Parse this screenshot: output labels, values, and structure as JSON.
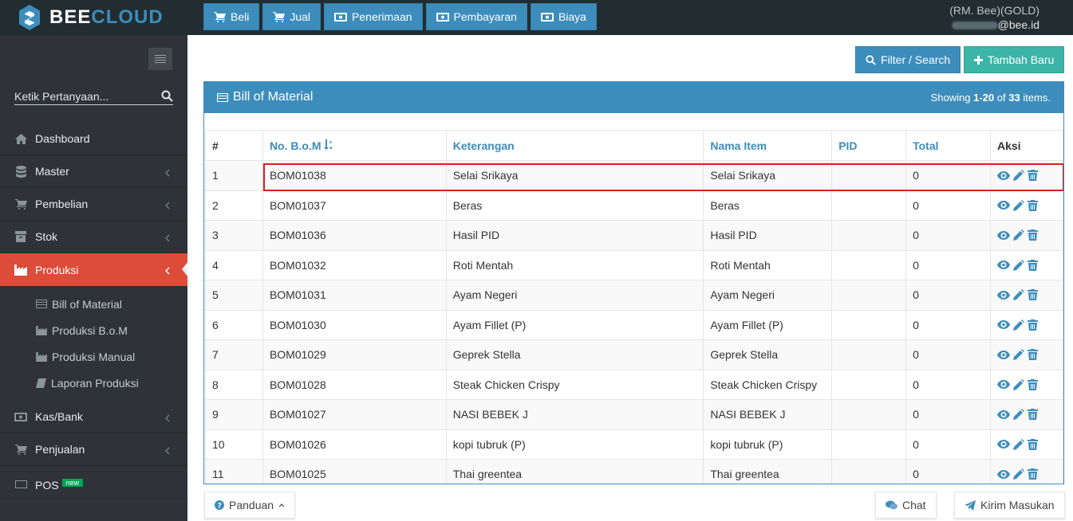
{
  "brand": {
    "name_part1": "BEE",
    "name_part2": "CLOUD"
  },
  "topnav": [
    {
      "label": "Beli",
      "icon": "cart-icon"
    },
    {
      "label": "Jual",
      "icon": "cart-icon"
    },
    {
      "label": "Penerimaan",
      "icon": "money-icon"
    },
    {
      "label": "Pembayaran",
      "icon": "money-icon"
    },
    {
      "label": "Biaya",
      "icon": "money-icon"
    }
  ],
  "user": {
    "account": "(RM. Bee)(GOLD)",
    "email_suffix": "@bee.id"
  },
  "sidebar": {
    "search_placeholder": "Ketik Pertanyaan...",
    "items": [
      {
        "label": "Dashboard",
        "icon": "home-icon"
      },
      {
        "label": "Master",
        "icon": "database-icon"
      },
      {
        "label": "Pembelian",
        "icon": "cart-icon"
      },
      {
        "label": "Stok",
        "icon": "box-icon"
      },
      {
        "label": "Produksi",
        "icon": "factory-icon"
      }
    ],
    "submenu": [
      {
        "label": "Bill of Material",
        "icon": "list-icon"
      },
      {
        "label": "Produksi B.o.M",
        "icon": "factory-icon"
      },
      {
        "label": "Produksi Manual",
        "icon": "factory-icon"
      },
      {
        "label": "Laporan Produksi",
        "icon": "book-icon"
      }
    ],
    "items_after": [
      {
        "label": "Kas/Bank",
        "icon": "money-icon"
      },
      {
        "label": "Penjualan",
        "icon": "cart-icon"
      },
      {
        "label": "POS",
        "icon": "monitor-icon",
        "badge": "new"
      }
    ]
  },
  "actions": {
    "filter_label": "Filter / Search",
    "new_label": "Tambah Baru"
  },
  "box": {
    "title": "Bill of Material",
    "showing_prefix": "Showing ",
    "showing_range": "1-20",
    "showing_mid": " of ",
    "showing_total": "33",
    "showing_suffix": " items."
  },
  "table": {
    "headers": [
      "#",
      "No. B.o.M",
      "Keterangan",
      "Nama Item",
      "PID",
      "Total",
      "Aksi"
    ],
    "rows": [
      [
        "1",
        "BOM01038",
        "Selai Srikaya",
        "Selai Srikaya",
        "",
        "0"
      ],
      [
        "2",
        "BOM01037",
        "Beras",
        "Beras",
        "",
        "0"
      ],
      [
        "3",
        "BOM01036",
        "Hasil PID",
        "Hasil PID",
        "",
        "0"
      ],
      [
        "4",
        "BOM01032",
        "Roti Mentah",
        "Roti Mentah",
        "",
        "0"
      ],
      [
        "5",
        "BOM01031",
        "Ayam Negeri",
        "Ayam Negeri",
        "",
        "0"
      ],
      [
        "6",
        "BOM01030",
        "Ayam Fillet (P)",
        "Ayam Fillet (P)",
        "",
        "0"
      ],
      [
        "7",
        "BOM01029",
        "Geprek Stella",
        "Geprek Stella",
        "",
        "0"
      ],
      [
        "8",
        "BOM01028",
        "Steak Chicken Crispy",
        "Steak Chicken Crispy",
        "",
        "0"
      ],
      [
        "9",
        "BOM01027",
        "NASI BEBEK J",
        "NASI BEBEK J",
        "",
        "0"
      ],
      [
        "10",
        "BOM01026",
        "kopi tubruk (P)",
        "kopi tubruk (P)",
        "",
        "0"
      ],
      [
        "11",
        "BOM01025",
        "Thai greentea",
        "Thai greentea",
        "",
        "0"
      ]
    ]
  },
  "footer": {
    "panduan_label": "Panduan",
    "chat_label": "Chat",
    "kirim_label": "Kirim Masukan"
  },
  "colors": {
    "primary": "#3c8dbc",
    "active_menu": "#dd4b39",
    "teal": "#3cb5a8",
    "highlight": "#e11b1b"
  }
}
